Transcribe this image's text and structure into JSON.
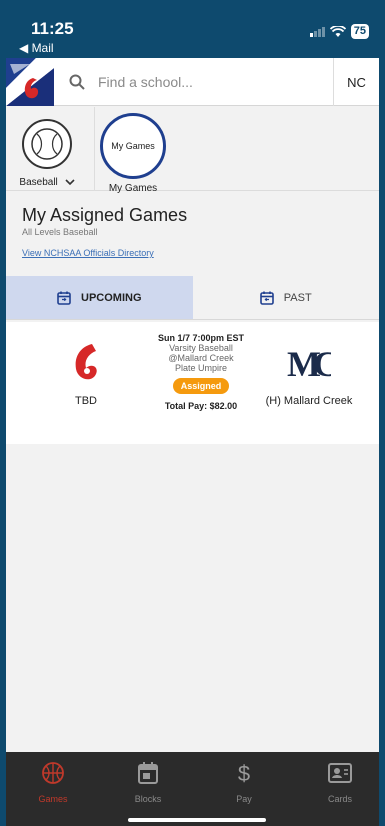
{
  "status": {
    "time": "11:25",
    "back_label": "◀ Mail",
    "battery": "75"
  },
  "search": {
    "placeholder": "Find a school...",
    "state_label": "NC"
  },
  "sports": [
    {
      "label": "Baseball",
      "icon": "baseball-icon"
    },
    {
      "label": "My Games",
      "circle_text": "My Games"
    }
  ],
  "page": {
    "title": "My Assigned Games",
    "subtitle": "All Levels Baseball",
    "directory_link": "View NCHSAA Officials Directory"
  },
  "tabs": {
    "upcoming": "UPCOMING",
    "past": "PAST"
  },
  "game": {
    "away_team": "TBD",
    "home_team": "(H) Mallard Creek",
    "home_logo_text": "MC",
    "datetime": "Sun 1/7 7:00pm EST",
    "level": "Varsity Baseball",
    "location": "@Mallard Creek",
    "position": "Plate Umpire",
    "status_badge": "Assigned",
    "total_pay": "Total Pay: $82.00"
  },
  "nav": {
    "games": "Games",
    "blocks": "Blocks",
    "pay": "Pay",
    "cards": "Cards"
  },
  "colors": {
    "accent_red": "#c0392b",
    "tab_active": "#cfd8ee",
    "badge_orange": "#f59a0e",
    "navy": "#1f3f8f",
    "statusbar": "#0e4a6e"
  }
}
